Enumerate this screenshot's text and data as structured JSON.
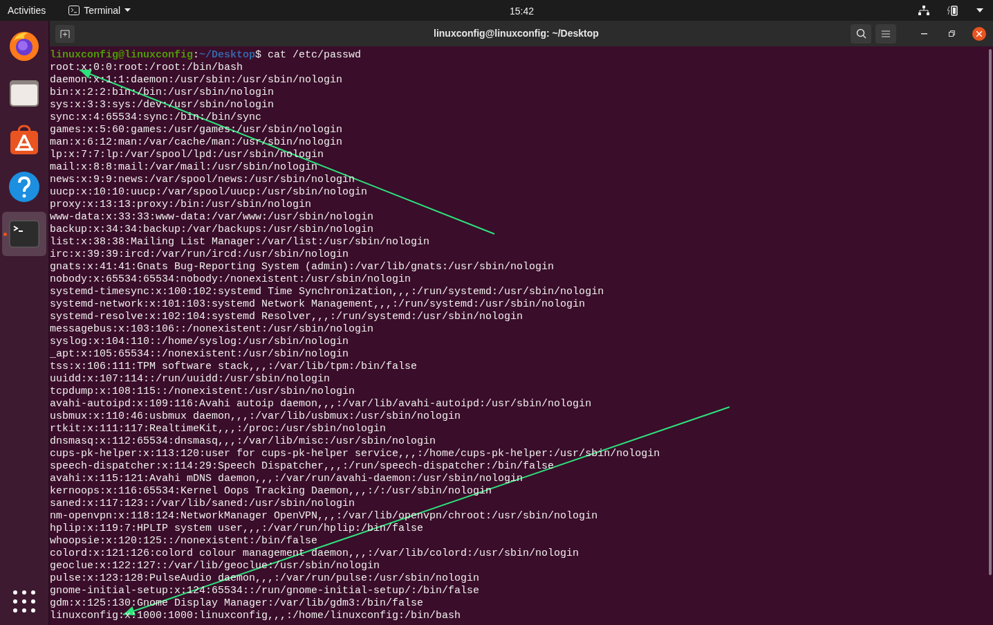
{
  "top_bar": {
    "activities": "Activities",
    "app_menu": "Terminal",
    "clock": "15:42"
  },
  "dock": [
    {
      "kind": "browser",
      "running": false
    },
    {
      "kind": "files",
      "running": false
    },
    {
      "kind": "software",
      "running": false
    },
    {
      "kind": "help",
      "running": false
    },
    {
      "kind": "terminal",
      "running": true
    }
  ],
  "window": {
    "title": "linuxconfig@linuxconfig: ~/Desktop"
  },
  "terminal": {
    "prompt": {
      "user": "linuxconfig@linuxconfig",
      "separator": ":",
      "path": "~/Desktop",
      "command": "$ cat /etc/passwd"
    },
    "lines": [
      "root:x:0:0:root:/root:/bin/bash",
      "daemon:x:1:1:daemon:/usr/sbin:/usr/sbin/nologin",
      "bin:x:2:2:bin:/bin:/usr/sbin/nologin",
      "sys:x:3:3:sys:/dev:/usr/sbin/nologin",
      "sync:x:4:65534:sync:/bin:/bin/sync",
      "games:x:5:60:games:/usr/games:/usr/sbin/nologin",
      "man:x:6:12:man:/var/cache/man:/usr/sbin/nologin",
      "lp:x:7:7:lp:/var/spool/lpd:/usr/sbin/nologin",
      "mail:x:8:8:mail:/var/mail:/usr/sbin/nologin",
      "news:x:9:9:news:/var/spool/news:/usr/sbin/nologin",
      "uucp:x:10:10:uucp:/var/spool/uucp:/usr/sbin/nologin",
      "proxy:x:13:13:proxy:/bin:/usr/sbin/nologin",
      "www-data:x:33:33:www-data:/var/www:/usr/sbin/nologin",
      "backup:x:34:34:backup:/var/backups:/usr/sbin/nologin",
      "list:x:38:38:Mailing List Manager:/var/list:/usr/sbin/nologin",
      "irc:x:39:39:ircd:/var/run/ircd:/usr/sbin/nologin",
      "gnats:x:41:41:Gnats Bug-Reporting System (admin):/var/lib/gnats:/usr/sbin/nologin",
      "nobody:x:65534:65534:nobody:/nonexistent:/usr/sbin/nologin",
      "systemd-timesync:x:100:102:systemd Time Synchronization,,,:/run/systemd:/usr/sbin/nologin",
      "systemd-network:x:101:103:systemd Network Management,,,:/run/systemd:/usr/sbin/nologin",
      "systemd-resolve:x:102:104:systemd Resolver,,,:/run/systemd:/usr/sbin/nologin",
      "messagebus:x:103:106::/nonexistent:/usr/sbin/nologin",
      "syslog:x:104:110::/home/syslog:/usr/sbin/nologin",
      "_apt:x:105:65534::/nonexistent:/usr/sbin/nologin",
      "tss:x:106:111:TPM software stack,,,:/var/lib/tpm:/bin/false",
      "uuidd:x:107:114::/run/uuidd:/usr/sbin/nologin",
      "tcpdump:x:108:115::/nonexistent:/usr/sbin/nologin",
      "avahi-autoipd:x:109:116:Avahi autoip daemon,,,:/var/lib/avahi-autoipd:/usr/sbin/nologin",
      "usbmux:x:110:46:usbmux daemon,,,:/var/lib/usbmux:/usr/sbin/nologin",
      "rtkit:x:111:117:RealtimeKit,,,:/proc:/usr/sbin/nologin",
      "dnsmasq:x:112:65534:dnsmasq,,,:/var/lib/misc:/usr/sbin/nologin",
      "cups-pk-helper:x:113:120:user for cups-pk-helper service,,,:/home/cups-pk-helper:/usr/sbin/nologin",
      "speech-dispatcher:x:114:29:Speech Dispatcher,,,:/run/speech-dispatcher:/bin/false",
      "avahi:x:115:121:Avahi mDNS daemon,,,:/var/run/avahi-daemon:/usr/sbin/nologin",
      "kernoops:x:116:65534:Kernel Oops Tracking Daemon,,,:/:/usr/sbin/nologin",
      "saned:x:117:123::/var/lib/saned:/usr/sbin/nologin",
      "nm-openvpn:x:118:124:NetworkManager OpenVPN,,,:/var/lib/openvpn/chroot:/usr/sbin/nologin",
      "hplip:x:119:7:HPLIP system user,,,:/var/run/hplip:/bin/false",
      "whoopsie:x:120:125::/nonexistent:/bin/false",
      "colord:x:121:126:colord colour management daemon,,,:/var/lib/colord:/usr/sbin/nologin",
      "geoclue:x:122:127::/var/lib/geoclue:/usr/sbin/nologin",
      "pulse:x:123:128:PulseAudio daemon,,,:/var/run/pulse:/usr/sbin/nologin",
      "gnome-initial-setup:x:124:65534::/run/gnome-initial-setup/:/bin/false",
      "gdm:x:125:130:Gnome Display Manager:/var/lib/gdm3:/bin/false",
      "linuxconfig:x:1000:1000:linuxconfig,,,:/home/linuxconfig:/bin/bash"
    ]
  }
}
